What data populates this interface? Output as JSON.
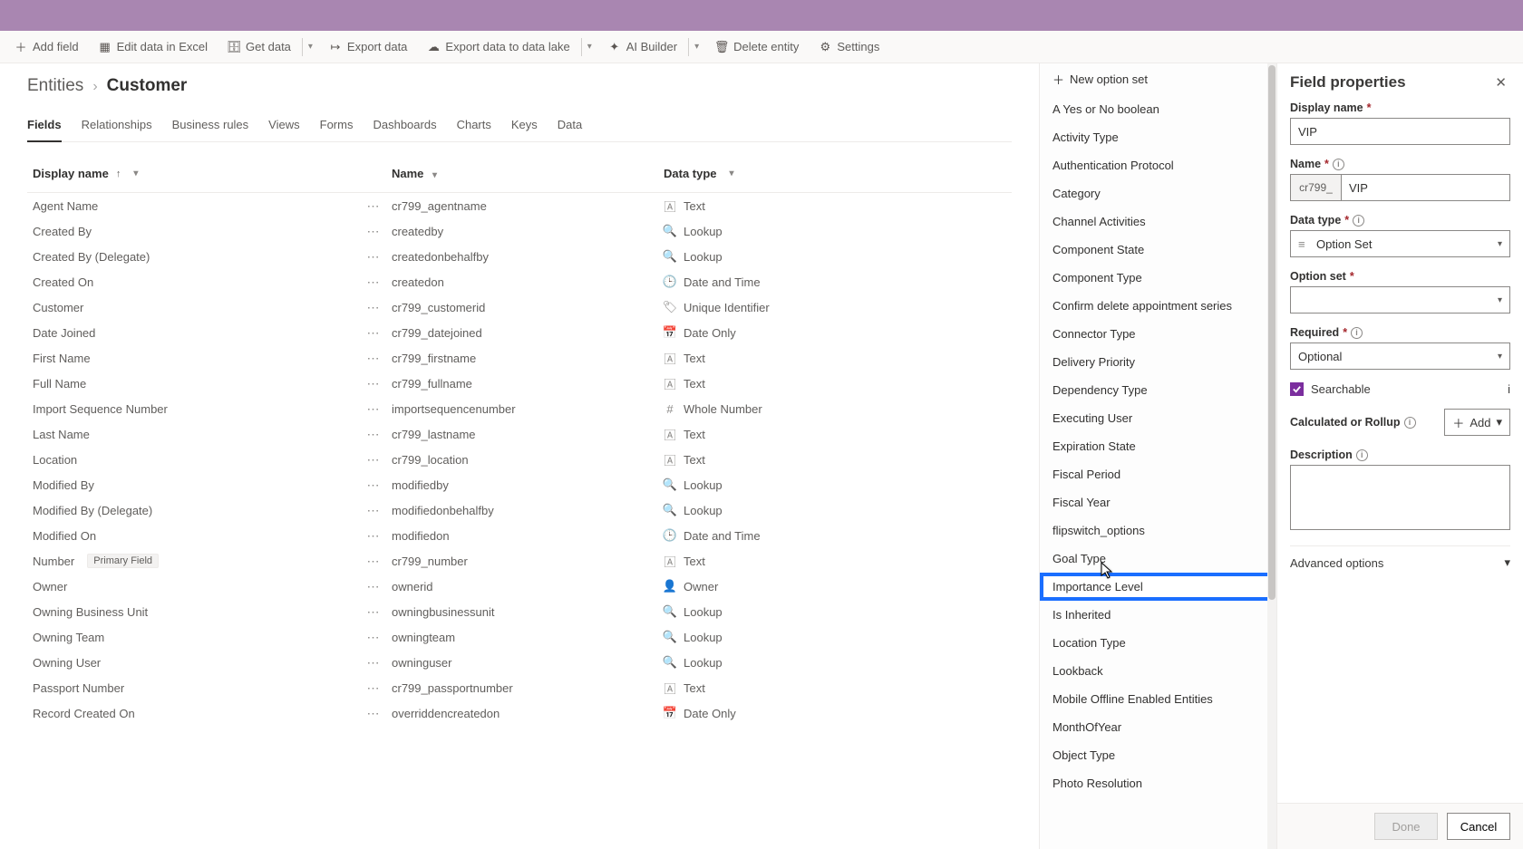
{
  "topbar": {},
  "commands": {
    "add_field": "Add field",
    "edit_excel": "Edit data in Excel",
    "get_data": "Get data",
    "export_data": "Export data",
    "export_lake": "Export data to data lake",
    "ai_builder": "AI Builder",
    "delete_entity": "Delete entity",
    "settings": "Settings"
  },
  "breadcrumb": {
    "root": "Entities",
    "leaf": "Customer"
  },
  "tabs": [
    "Fields",
    "Relationships",
    "Business rules",
    "Views",
    "Forms",
    "Dashboards",
    "Charts",
    "Keys",
    "Data"
  ],
  "active_tab": "Fields",
  "columns": {
    "display": "Display name",
    "name": "Name",
    "datatype": "Data type"
  },
  "rows": [
    {
      "display": "Agent Name",
      "name": "cr799_agentname",
      "type": "Text",
      "icon": "text"
    },
    {
      "display": "Created By",
      "name": "createdby",
      "type": "Lookup",
      "icon": "lookup"
    },
    {
      "display": "Created By (Delegate)",
      "name": "createdonbehalfby",
      "type": "Lookup",
      "icon": "lookup"
    },
    {
      "display": "Created On",
      "name": "createdon",
      "type": "Date and Time",
      "icon": "datetime"
    },
    {
      "display": "Customer",
      "name": "cr799_customerid",
      "type": "Unique Identifier",
      "icon": "uid"
    },
    {
      "display": "Date Joined",
      "name": "cr799_datejoined",
      "type": "Date Only",
      "icon": "date"
    },
    {
      "display": "First Name",
      "name": "cr799_firstname",
      "type": "Text",
      "icon": "text"
    },
    {
      "display": "Full Name",
      "name": "cr799_fullname",
      "type": "Text",
      "icon": "text"
    },
    {
      "display": "Import Sequence Number",
      "name": "importsequencenumber",
      "type": "Whole Number",
      "icon": "number"
    },
    {
      "display": "Last Name",
      "name": "cr799_lastname",
      "type": "Text",
      "icon": "text"
    },
    {
      "display": "Location",
      "name": "cr799_location",
      "type": "Text",
      "icon": "text"
    },
    {
      "display": "Modified By",
      "name": "modifiedby",
      "type": "Lookup",
      "icon": "lookup"
    },
    {
      "display": "Modified By (Delegate)",
      "name": "modifiedonbehalfby",
      "type": "Lookup",
      "icon": "lookup"
    },
    {
      "display": "Modified On",
      "name": "modifiedon",
      "type": "Date and Time",
      "icon": "datetime"
    },
    {
      "display": "Number",
      "name": "cr799_number",
      "type": "Text",
      "icon": "text",
      "primary": true
    },
    {
      "display": "Owner",
      "name": "ownerid",
      "type": "Owner",
      "icon": "owner"
    },
    {
      "display": "Owning Business Unit",
      "name": "owningbusinessunit",
      "type": "Lookup",
      "icon": "lookup"
    },
    {
      "display": "Owning Team",
      "name": "owningteam",
      "type": "Lookup",
      "icon": "lookup"
    },
    {
      "display": "Owning User",
      "name": "owninguser",
      "type": "Lookup",
      "icon": "lookup"
    },
    {
      "display": "Passport Number",
      "name": "cr799_passportnumber",
      "type": "Text",
      "icon": "text"
    },
    {
      "display": "Record Created On",
      "name": "overriddencreatedon",
      "type": "Date Only",
      "icon": "date"
    }
  ],
  "primary_badge": "Primary Field",
  "optionset_new": "New option set",
  "optionsets": [
    "A Yes or No boolean",
    "Activity Type",
    "Authentication Protocol",
    "Category",
    "Channel Activities",
    "Component State",
    "Component Type",
    "Confirm delete appointment series",
    "Connector Type",
    "Delivery Priority",
    "Dependency Type",
    "Executing User",
    "Expiration State",
    "Fiscal Period",
    "Fiscal Year",
    "flipswitch_options",
    "Goal Type",
    "Importance Level",
    "Is Inherited",
    "Location Type",
    "Lookback",
    "Mobile Offline Enabled Entities",
    "MonthOfYear",
    "Object Type",
    "Photo Resolution"
  ],
  "optionset_highlight": "Importance Level",
  "props": {
    "panel_title": "Field properties",
    "display_label": "Display name",
    "display_value": "VIP",
    "name_label": "Name",
    "name_prefix": "cr799_",
    "name_value": "VIP",
    "datatype_label": "Data type",
    "datatype_value": "Option Set",
    "optionset_label": "Option set",
    "optionset_value": "",
    "required_label": "Required",
    "required_value": "Optional",
    "searchable_label": "Searchable",
    "rollup_label": "Calculated or Rollup",
    "add_label": "Add",
    "description_label": "Description",
    "advanced_label": "Advanced options",
    "done": "Done",
    "cancel": "Cancel"
  }
}
